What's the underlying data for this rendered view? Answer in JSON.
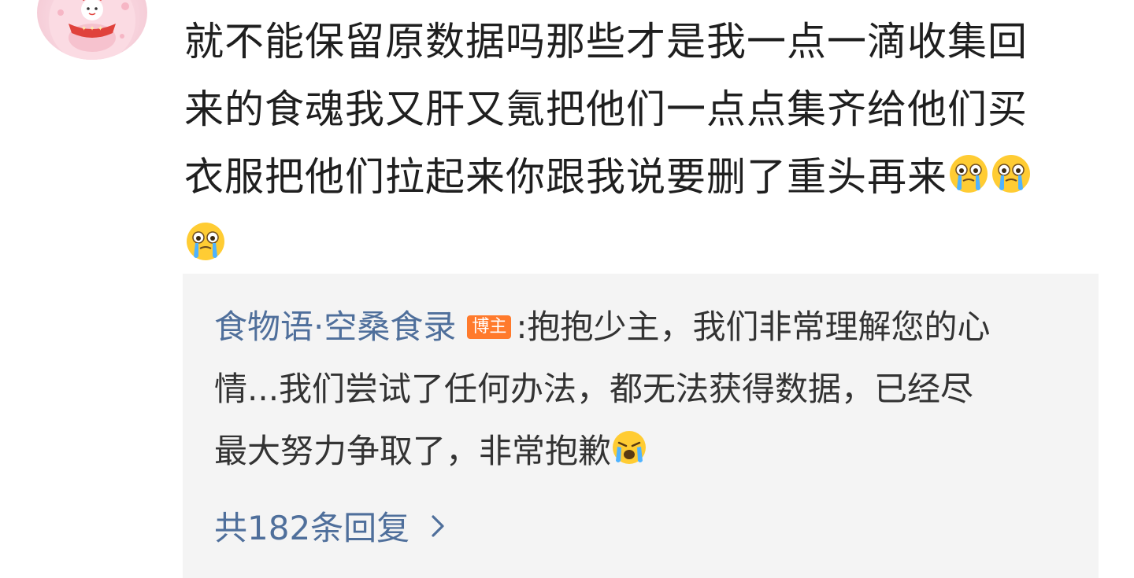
{
  "comment": {
    "lines": [
      "就不能保留原数据吗那些才是我一点一滴收集回",
      "来的食魂我又肝又氪把他们一点点集齐给他们买",
      "衣服把他们拉起来你跟我说要删了重头再来"
    ],
    "emoji": "crying-emoji"
  },
  "avatar": {
    "label": "avatar"
  },
  "reply": {
    "author": "食物语·空桑食录",
    "badge": "博主",
    "separator": ":",
    "line1_text": "抱抱少主，我们非常理解您的心",
    "line2_text": "情...我们尝试了任何办法，都无法获得数据，已经尽",
    "line3_text": "最大努力争取了，非常抱歉",
    "emoji": "sobbing-emoji"
  },
  "reply_count": {
    "label": "共182条回复"
  },
  "colors": {
    "link_blue": "#4f6f9b",
    "badge_orange": "#ff7a2c",
    "panel_bg": "#f4f4f4",
    "text": "#1f1f1f"
  }
}
